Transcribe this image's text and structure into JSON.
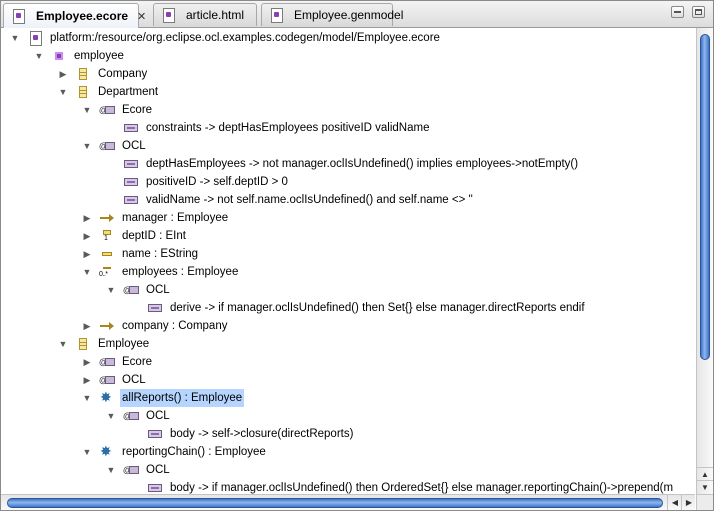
{
  "tabs": [
    {
      "label": "Employee.ecore",
      "active": true,
      "icon": "ecore-resource-icon"
    },
    {
      "label": "article.html",
      "active": false,
      "icon": "html-file-icon"
    },
    {
      "label": "Employee.genmodel",
      "active": false,
      "icon": "genmodel-file-icon"
    }
  ],
  "tree": {
    "rows": [
      {
        "label": "platform:/resource/org.eclipse.ocl.examples.codegen/model/Employee.ecore",
        "icon": "ecore-resource-icon",
        "expanded": true
      },
      {
        "label": "employee",
        "icon": "epackage-icon",
        "expanded": true
      },
      {
        "label": "Company",
        "icon": "eclass-icon",
        "expanded": false
      },
      {
        "label": "Department",
        "icon": "eclass-icon",
        "expanded": true
      },
      {
        "label": "Ecore",
        "icon": "eannotation-icon",
        "expanded": true
      },
      {
        "label": "constraints -> deptHasEmployees positiveID validName",
        "icon": "details-entry-icon"
      },
      {
        "label": "OCL",
        "icon": "eannotation-icon",
        "expanded": true
      },
      {
        "label": "deptHasEmployees -> not manager.oclIsUndefined() implies employees->notEmpty()",
        "icon": "details-entry-icon"
      },
      {
        "label": "positiveID -> self.deptID > 0",
        "icon": "details-entry-icon"
      },
      {
        "label": "validName -> not self.name.oclIsUndefined() and self.name <> ''",
        "icon": "details-entry-icon"
      },
      {
        "label": "manager : Employee",
        "icon": "ereference-icon",
        "expanded": false
      },
      {
        "label": "deptID : EInt",
        "icon": "eattribute-required-icon",
        "expanded": false
      },
      {
        "label": "name : EString",
        "icon": "eattribute-icon",
        "expanded": false
      },
      {
        "label": "employees : Employee",
        "icon": "ereference-many-icon",
        "expanded": true
      },
      {
        "label": "OCL",
        "icon": "eannotation-icon",
        "expanded": true
      },
      {
        "label": "derive -> if manager.oclIsUndefined() then Set{} else manager.directReports endif",
        "icon": "details-entry-icon"
      },
      {
        "label": "company : Company",
        "icon": "ereference-icon",
        "expanded": false
      },
      {
        "label": "Employee",
        "icon": "eclass-icon",
        "expanded": true
      },
      {
        "label": "Ecore",
        "icon": "eannotation-icon",
        "expanded": false
      },
      {
        "label": "OCL",
        "icon": "eannotation-icon",
        "expanded": false
      },
      {
        "label": "allReports() : Employee",
        "icon": "eoperation-icon",
        "expanded": true,
        "selected": true
      },
      {
        "label": "OCL",
        "icon": "eannotation-icon",
        "expanded": true
      },
      {
        "label": "body -> self->closure(directReports)",
        "icon": "details-entry-icon"
      },
      {
        "label": "reportingChain() : Employee",
        "icon": "eoperation-icon",
        "expanded": true
      },
      {
        "label": "OCL",
        "icon": "eannotation-icon",
        "expanded": true
      },
      {
        "label": "body -> if manager.oclIsUndefined() then OrderedSet{} else manager.reportingChain()->prepend(m",
        "icon": "details-entry-icon"
      }
    ]
  },
  "colors": {
    "selection": "#b5d5ff",
    "scroll_thumb": "#5a8ee0",
    "package": "#8a3db5",
    "class_fill": "#f6e9a8",
    "operation": "#2f6fa8"
  }
}
